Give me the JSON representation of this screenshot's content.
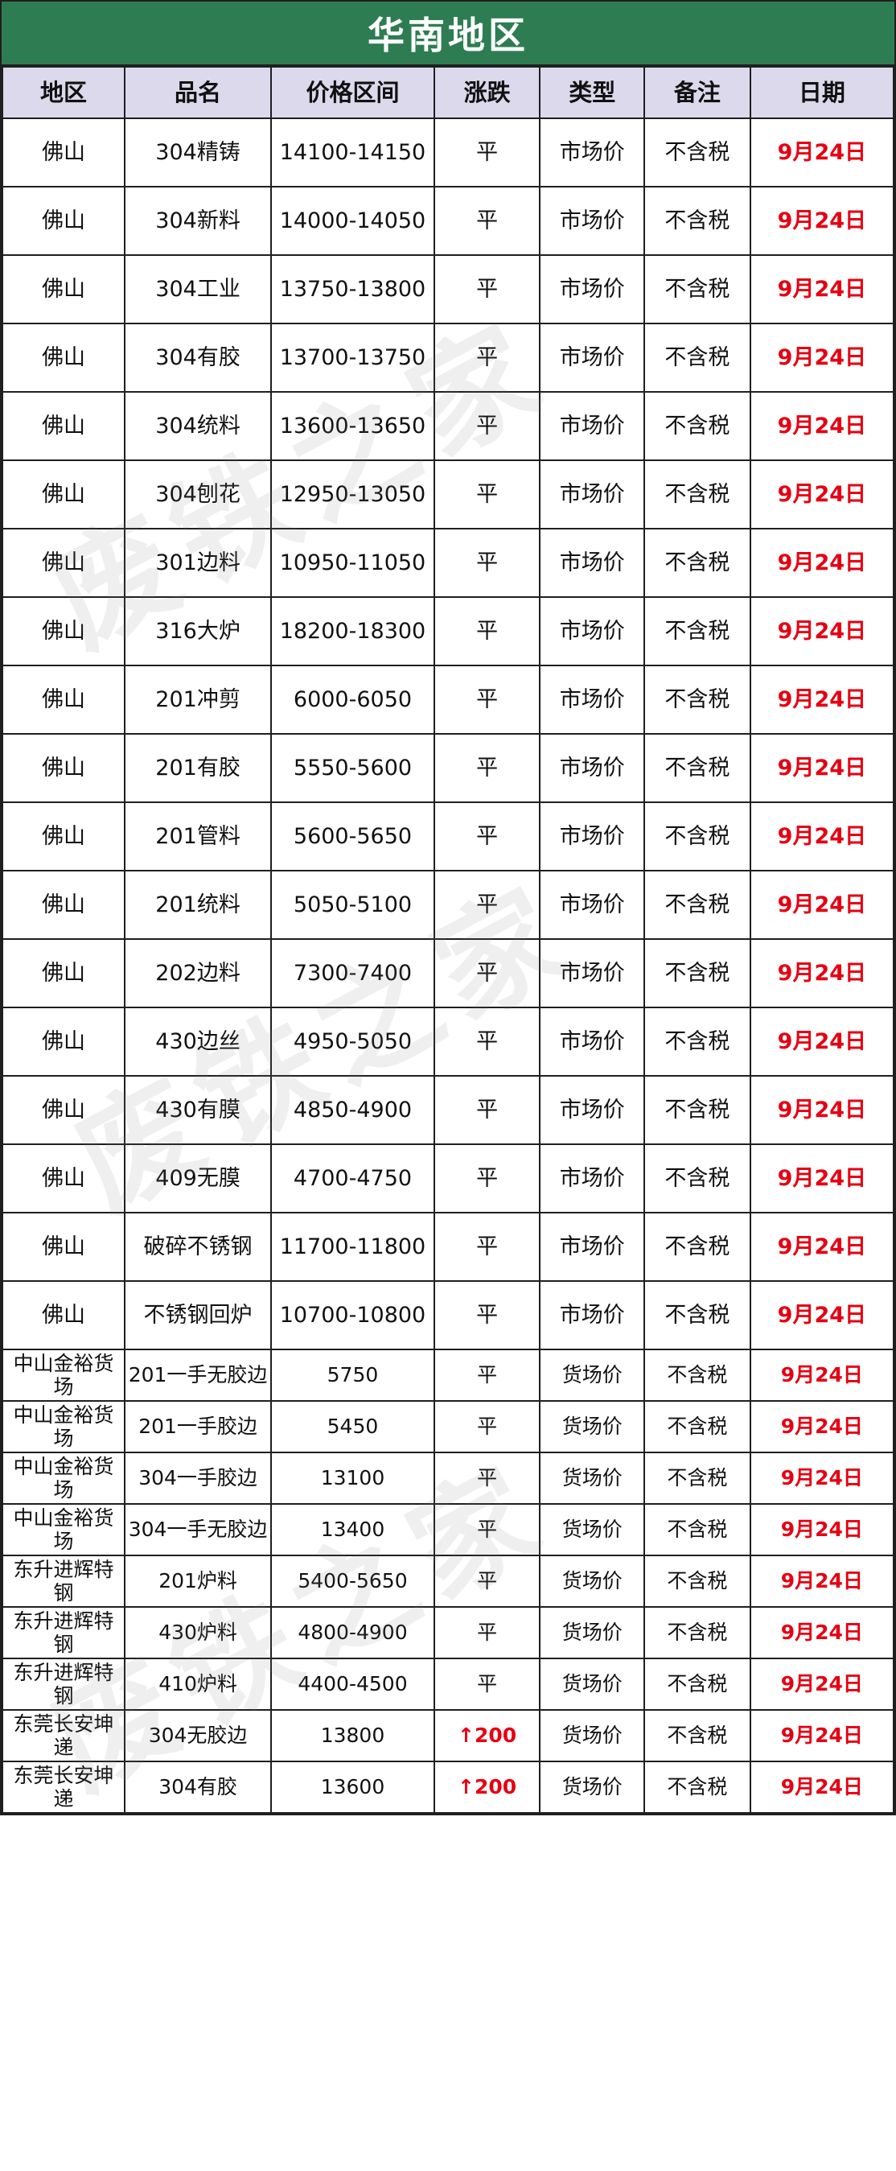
{
  "title": "华南地区",
  "watermark": "废铁之家",
  "accent_color": "#2e7d52",
  "header_bg": "#dcd9ec",
  "date_color": "#e60012",
  "columns": [
    {
      "key": "region",
      "label": "地区"
    },
    {
      "key": "product",
      "label": "品名"
    },
    {
      "key": "price",
      "label": "价格区间"
    },
    {
      "key": "change",
      "label": "涨跌"
    },
    {
      "key": "type",
      "label": "类型"
    },
    {
      "key": "note",
      "label": "备注"
    },
    {
      "key": "date",
      "label": "日期"
    }
  ],
  "rows": [
    {
      "region": "佛山",
      "product": "304精铸",
      "price": "14100-14150",
      "change": "平",
      "type": "市场价",
      "note": "不含税",
      "date": "9月24日",
      "compact": false,
      "up": false
    },
    {
      "region": "佛山",
      "product": "304新料",
      "price": "14000-14050",
      "change": "平",
      "type": "市场价",
      "note": "不含税",
      "date": "9月24日",
      "compact": false,
      "up": false
    },
    {
      "region": "佛山",
      "product": "304工业",
      "price": "13750-13800",
      "change": "平",
      "type": "市场价",
      "note": "不含税",
      "date": "9月24日",
      "compact": false,
      "up": false
    },
    {
      "region": "佛山",
      "product": "304有胶",
      "price": "13700-13750",
      "change": "平",
      "type": "市场价",
      "note": "不含税",
      "date": "9月24日",
      "compact": false,
      "up": false
    },
    {
      "region": "佛山",
      "product": "304统料",
      "price": "13600-13650",
      "change": "平",
      "type": "市场价",
      "note": "不含税",
      "date": "9月24日",
      "compact": false,
      "up": false
    },
    {
      "region": "佛山",
      "product": "304刨花",
      "price": "12950-13050",
      "change": "平",
      "type": "市场价",
      "note": "不含税",
      "date": "9月24日",
      "compact": false,
      "up": false
    },
    {
      "region": "佛山",
      "product": "301边料",
      "price": "10950-11050",
      "change": "平",
      "type": "市场价",
      "note": "不含税",
      "date": "9月24日",
      "compact": false,
      "up": false
    },
    {
      "region": "佛山",
      "product": "316大炉",
      "price": "18200-18300",
      "change": "平",
      "type": "市场价",
      "note": "不含税",
      "date": "9月24日",
      "compact": false,
      "up": false
    },
    {
      "region": "佛山",
      "product": "201冲剪",
      "price": "6000-6050",
      "change": "平",
      "type": "市场价",
      "note": "不含税",
      "date": "9月24日",
      "compact": false,
      "up": false
    },
    {
      "region": "佛山",
      "product": "201有胶",
      "price": "5550-5600",
      "change": "平",
      "type": "市场价",
      "note": "不含税",
      "date": "9月24日",
      "compact": false,
      "up": false
    },
    {
      "region": "佛山",
      "product": "201管料",
      "price": "5600-5650",
      "change": "平",
      "type": "市场价",
      "note": "不含税",
      "date": "9月24日",
      "compact": false,
      "up": false
    },
    {
      "region": "佛山",
      "product": "201统料",
      "price": "5050-5100",
      "change": "平",
      "type": "市场价",
      "note": "不含税",
      "date": "9月24日",
      "compact": false,
      "up": false
    },
    {
      "region": "佛山",
      "product": "202边料",
      "price": "7300-7400",
      "change": "平",
      "type": "市场价",
      "note": "不含税",
      "date": "9月24日",
      "compact": false,
      "up": false
    },
    {
      "region": "佛山",
      "product": "430边丝",
      "price": "4950-5050",
      "change": "平",
      "type": "市场价",
      "note": "不含税",
      "date": "9月24日",
      "compact": false,
      "up": false
    },
    {
      "region": "佛山",
      "product": "430有膜",
      "price": "4850-4900",
      "change": "平",
      "type": "市场价",
      "note": "不含税",
      "date": "9月24日",
      "compact": false,
      "up": false
    },
    {
      "region": "佛山",
      "product": "409无膜",
      "price": "4700-4750",
      "change": "平",
      "type": "市场价",
      "note": "不含税",
      "date": "9月24日",
      "compact": false,
      "up": false
    },
    {
      "region": "佛山",
      "product": "破碎不锈钢",
      "price": "11700-11800",
      "change": "平",
      "type": "市场价",
      "note": "不含税",
      "date": "9月24日",
      "compact": false,
      "up": false
    },
    {
      "region": "佛山",
      "product": "不锈钢回炉",
      "price": "10700-10800",
      "change": "平",
      "type": "市场价",
      "note": "不含税",
      "date": "9月24日",
      "compact": false,
      "up": false
    },
    {
      "region": "中山金裕货场",
      "product": "201一手无胶边",
      "price": "5750",
      "change": "平",
      "type": "货场价",
      "note": "不含税",
      "date": "9月24日",
      "compact": true,
      "up": false
    },
    {
      "region": "中山金裕货场",
      "product": "201一手胶边",
      "price": "5450",
      "change": "平",
      "type": "货场价",
      "note": "不含税",
      "date": "9月24日",
      "compact": true,
      "up": false
    },
    {
      "region": "中山金裕货场",
      "product": "304一手胶边",
      "price": "13100",
      "change": "平",
      "type": "货场价",
      "note": "不含税",
      "date": "9月24日",
      "compact": true,
      "up": false
    },
    {
      "region": "中山金裕货场",
      "product": "304一手无胶边",
      "price": "13400",
      "change": "平",
      "type": "货场价",
      "note": "不含税",
      "date": "9月24日",
      "compact": true,
      "up": false
    },
    {
      "region": "东升进辉特钢",
      "product": "201炉料",
      "price": "5400-5650",
      "change": "平",
      "type": "货场价",
      "note": "不含税",
      "date": "9月24日",
      "compact": true,
      "up": false
    },
    {
      "region": "东升进辉特钢",
      "product": "430炉料",
      "price": "4800-4900",
      "change": "平",
      "type": "货场价",
      "note": "不含税",
      "date": "9月24日",
      "compact": true,
      "up": false
    },
    {
      "region": "东升进辉特钢",
      "product": "410炉料",
      "price": "4400-4500",
      "change": "平",
      "type": "货场价",
      "note": "不含税",
      "date": "9月24日",
      "compact": true,
      "up": false
    },
    {
      "region": "东莞长安坤递",
      "product": "304无胶边",
      "price": "13800",
      "change": "↑200",
      "type": "货场价",
      "note": "不含税",
      "date": "9月24日",
      "compact": true,
      "up": true
    },
    {
      "region": "东莞长安坤递",
      "product": "304有胶",
      "price": "13600",
      "change": "↑200",
      "type": "货场价",
      "note": "不含税",
      "date": "9月24日",
      "compact": true,
      "up": true
    }
  ]
}
